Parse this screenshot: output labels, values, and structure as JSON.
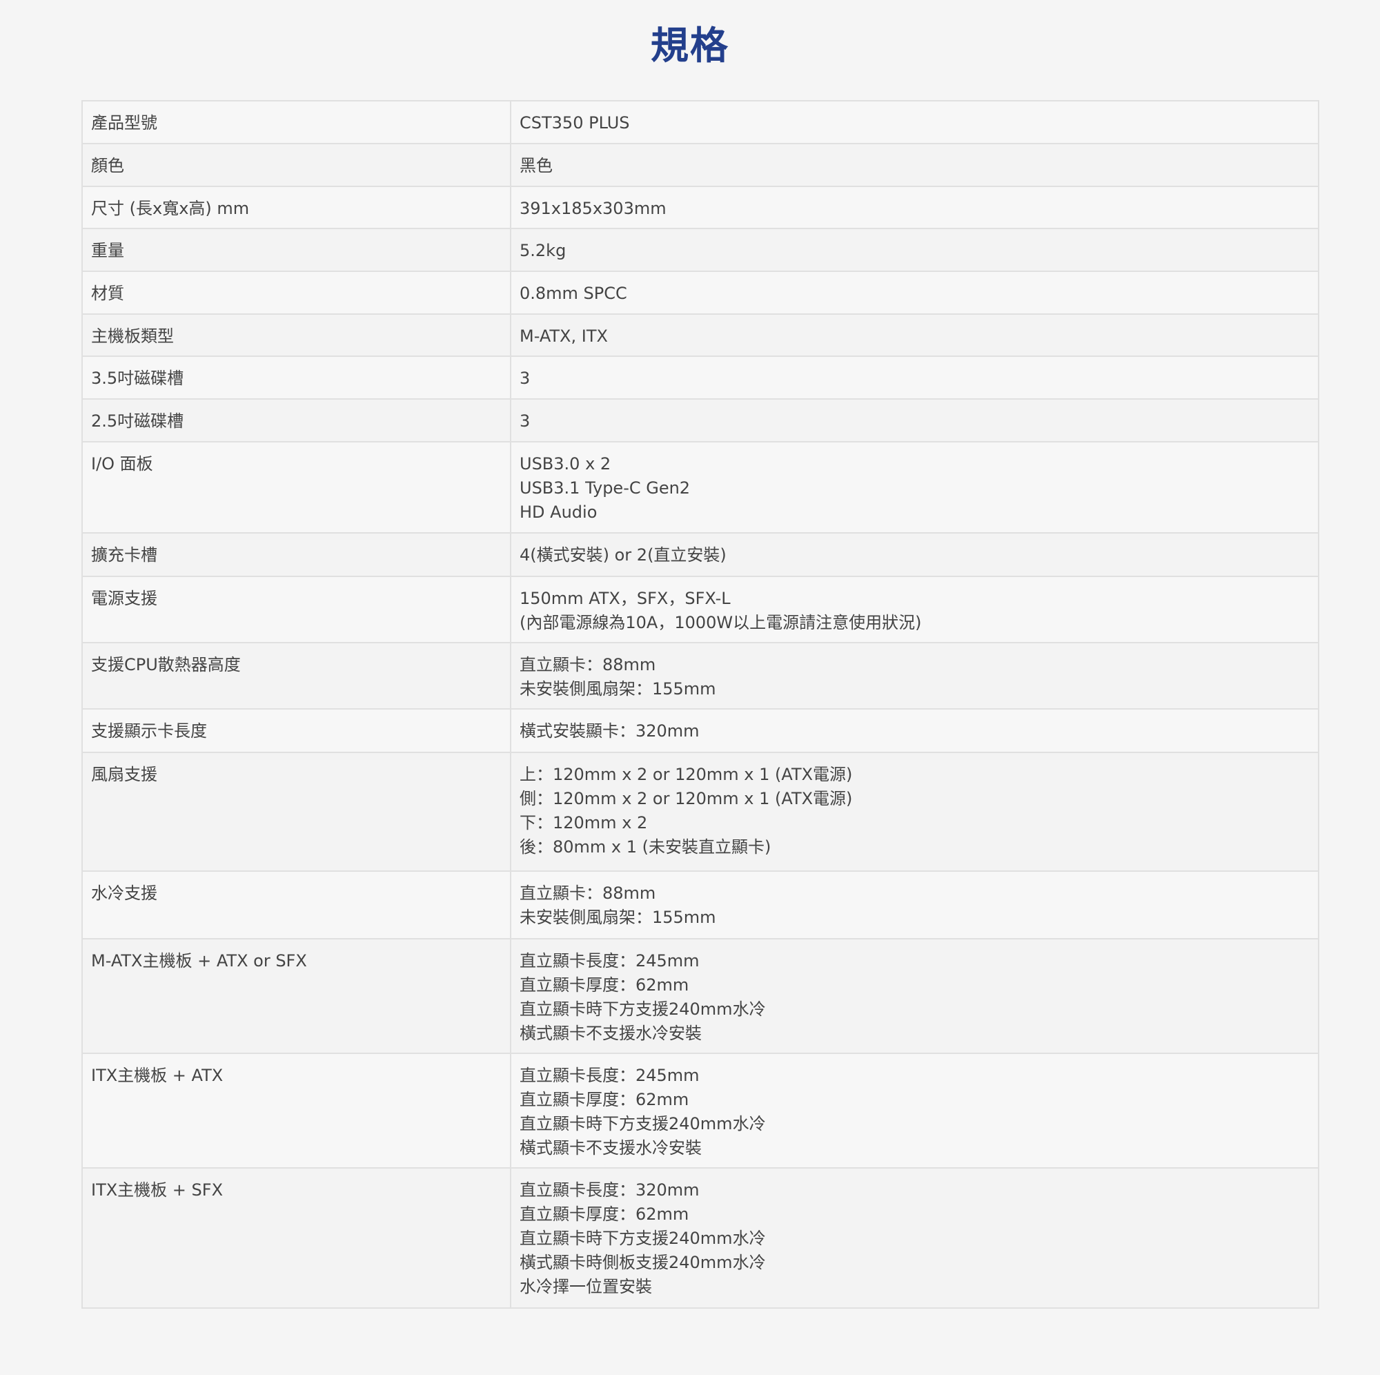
{
  "title": "規格",
  "specs": [
    {
      "label": "產品型號",
      "lines": [
        "CST350 PLUS"
      ]
    },
    {
      "label": "顏色",
      "lines": [
        "黑色"
      ]
    },
    {
      "label": "尺寸 (長x寬x高) mm",
      "lines": [
        "391x185x303mm"
      ]
    },
    {
      "label": "重量",
      "lines": [
        "5.2kg"
      ]
    },
    {
      "label": "材質",
      "lines": [
        "0.8mm SPCC"
      ]
    },
    {
      "label": "主機板類型",
      "lines": [
        "M-ATX, ITX"
      ]
    },
    {
      "label": "3.5吋磁碟槽",
      "lines": [
        "3"
      ]
    },
    {
      "label": "2.5吋磁碟槽",
      "lines": [
        "3"
      ]
    },
    {
      "label": "I/O 面板",
      "lines": [
        "USB3.0 x 2",
        "USB3.1 Type-C Gen2",
        "HD Audio"
      ]
    },
    {
      "label": "擴充卡槽",
      "lines": [
        "4(橫式安裝) or 2(直立安裝)"
      ]
    },
    {
      "label": "電源支援",
      "lines": [
        "150mm ATX，SFX，SFX-L",
        "(內部電源線為10A，1000W以上電源請注意使用狀況)"
      ]
    },
    {
      "label": "支援CPU散熱器高度",
      "lines": [
        "直立顯卡：88mm",
        "未安裝側風扇架：155mm"
      ]
    },
    {
      "label": "支援顯示卡長度",
      "lines": [
        "橫式安裝顯卡：320mm"
      ]
    },
    {
      "label": "風扇支援",
      "lines": [
        "上：120mm x 2 or 120mm x 1 (ATX電源)",
        "側：120mm x 2 or 120mm x 1 (ATX電源)",
        "下：120mm x 2",
        "後：80mm x 1 (未安裝直立顯卡)"
      ]
    },
    {
      "label": "水冷支援",
      "lines": [
        "直立顯卡：88mm",
        "未安裝側風扇架：155mm"
      ]
    },
    {
      "label": "M-ATX主機板 + ATX or SFX",
      "lines": [
        "直立顯卡長度：245mm",
        "直立顯卡厚度：62mm",
        "直立顯卡時下方支援240mm水冷",
        "橫式顯卡不支援水冷安裝"
      ]
    },
    {
      "label": "ITX主機板 + ATX",
      "lines": [
        "直立顯卡長度：245mm",
        "直立顯卡厚度：62mm",
        "直立顯卡時下方支援240mm水冷",
        "橫式顯卡不支援水冷安裝"
      ]
    },
    {
      "label": "ITX主機板 + SFX",
      "lines": [
        "直立顯卡長度：320mm",
        "直立顯卡厚度：62mm",
        "直立顯卡時下方支援240mm水冷",
        "橫式顯卡時側板支援240mm水冷",
        "水冷擇一位置安裝"
      ]
    }
  ]
}
